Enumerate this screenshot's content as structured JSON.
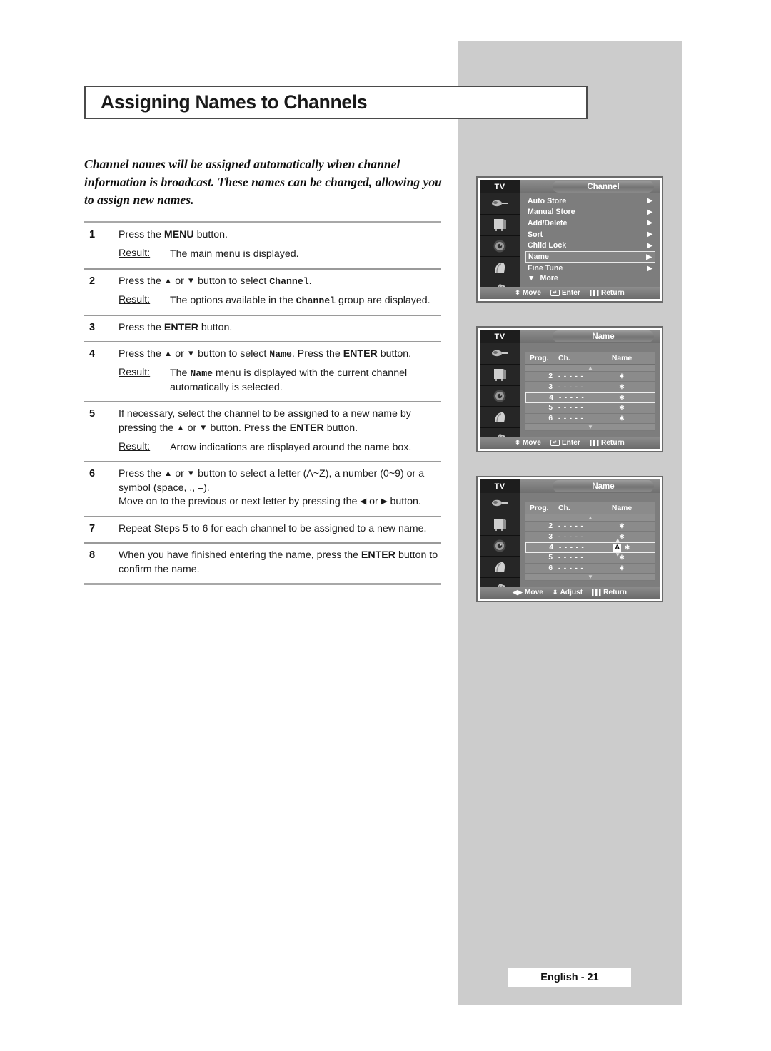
{
  "page": {
    "title": "Assigning Names to Channels",
    "intro": "Channel names will be assigned automatically when channel information is broadcast. These names can be changed, allowing you to assign new names.",
    "footer_label": "English - 21",
    "panel_color": "#cccccc",
    "osd_background": "#7d7d7d",
    "text_color": "#1a1a1a"
  },
  "steps": [
    {
      "number": "1",
      "lines": [
        "Press the MENU button."
      ],
      "result_label": "Result:",
      "result": "The main menu is displayed."
    },
    {
      "number": "2",
      "lines": [
        "Press the ▲ or ▼ button to select Channel."
      ],
      "result_label": "Result:",
      "result": "The options available in the Channel group are displayed."
    },
    {
      "number": "3",
      "lines": [
        "Press the ENTER button."
      ],
      "result_label": "",
      "result": ""
    },
    {
      "number": "4",
      "lines": [
        "Press the ▲ or ▼ button to select Name. Press the ENTER button."
      ],
      "result_label": "Result:",
      "result": "The Name menu is displayed with the current channel automatically is selected."
    },
    {
      "number": "5",
      "lines": [
        "If necessary, select the channel to be assigned to a new name by pressing the ▲ or ▼ button. Press the ENTER button."
      ],
      "result_label": "Result:",
      "result": "Arrow indications are displayed around the name box."
    },
    {
      "number": "6",
      "lines": [
        "Press the ▲ or ▼ button to select a letter (A~Z), a number (0~9) or a symbol (space, ., –).",
        "Move on to the previous or next letter by pressing the ◀ or ▶ button."
      ],
      "result_label": "",
      "result": ""
    },
    {
      "number": "7",
      "lines": [
        "Repeat Steps 5 to 6 for each channel to be assigned to a new name."
      ],
      "result_label": "",
      "result": ""
    },
    {
      "number": "8",
      "lines": [
        "When you have finished entering the name, press the ENTER button to confirm the name."
      ],
      "result_label": "",
      "result": ""
    }
  ],
  "osd_screens": [
    {
      "id": "channel-menu",
      "source_label": "TV",
      "title": "Channel",
      "menu_items": [
        {
          "label": "Auto Store",
          "selected": false
        },
        {
          "label": "Manual Store",
          "selected": false
        },
        {
          "label": "Add/Delete",
          "selected": false
        },
        {
          "label": "Sort",
          "selected": false
        },
        {
          "label": "Child Lock",
          "selected": false
        },
        {
          "label": "Name",
          "selected": true
        },
        {
          "label": "Fine Tune",
          "selected": false
        }
      ],
      "more_label": "More",
      "footer": [
        {
          "glyph": "updown",
          "label": "Move"
        },
        {
          "glyph": "enter",
          "label": "Enter"
        },
        {
          "glyph": "return",
          "label": "Return"
        }
      ]
    },
    {
      "id": "name-list",
      "source_label": "TV",
      "title": "Name",
      "columns": {
        "prog": "Prog.",
        "ch": "Ch.",
        "name": "Name"
      },
      "rows": [
        {
          "prog": "2",
          "ch": "- - - - -",
          "name": "∗",
          "selected": false
        },
        {
          "prog": "3",
          "ch": "- - - - -",
          "name": "∗",
          "selected": false
        },
        {
          "prog": "4",
          "ch": "- - - - -",
          "name": "∗",
          "selected": true
        },
        {
          "prog": "5",
          "ch": "- - - - -",
          "name": "∗",
          "selected": false
        },
        {
          "prog": "6",
          "ch": "- - - - -",
          "name": "∗",
          "selected": false
        }
      ],
      "footer": [
        {
          "glyph": "updown",
          "label": "Move"
        },
        {
          "glyph": "enter",
          "label": "Enter"
        },
        {
          "glyph": "return",
          "label": "Return"
        }
      ]
    },
    {
      "id": "name-edit",
      "source_label": "TV",
      "title": "Name",
      "columns": {
        "prog": "Prog.",
        "ch": "Ch.",
        "name": "Name"
      },
      "rows": [
        {
          "prog": "2",
          "ch": "- - - - -",
          "name": "∗",
          "selected": false
        },
        {
          "prog": "3",
          "ch": "- - - - -",
          "name": "∗",
          "selected": false
        },
        {
          "prog": "4",
          "ch": "- - - - -",
          "name": "∗",
          "selected": true,
          "edit_letter": "A"
        },
        {
          "prog": "5",
          "ch": "- - - - -",
          "name": "∗",
          "selected": false
        },
        {
          "prog": "6",
          "ch": "- - - - -",
          "name": "∗",
          "selected": false
        }
      ],
      "footer": [
        {
          "glyph": "leftright",
          "label": "Move"
        },
        {
          "glyph": "updown",
          "label": "Adjust"
        },
        {
          "glyph": "return",
          "label": "Return"
        }
      ]
    }
  ]
}
